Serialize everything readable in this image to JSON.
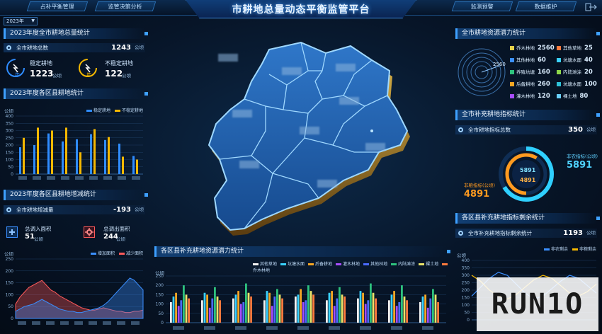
{
  "header": {
    "title": "市耕地总量动态平衡监管平台",
    "nav_left": [
      "占补平衡管理",
      "监管决策分析"
    ],
    "nav_right": [
      "监测预警",
      "数据维护"
    ],
    "year": "2023年",
    "exit_icon": "logout-icon"
  },
  "left": {
    "total": {
      "title": "2023年度全市耕地总量统计",
      "row_label": "全市耕地总数",
      "row_value": "1243",
      "row_unit": "公顷",
      "stable_label": "稳定耕地",
      "stable_value": "1223",
      "stable_unit": "公顷",
      "unstable_label": "不稳定耕地",
      "unstable_value": "122",
      "unstable_unit": "公顷",
      "icon_text": "年"
    },
    "county": {
      "title": "2023年度各区县耕地统计",
      "unit": "公顷",
      "legend": [
        "稳定耕地",
        "不稳定耕地"
      ],
      "colors": [
        "#2f8cff",
        "#f5b800"
      ]
    },
    "change": {
      "title": "2023年度各区县耕地增减统计",
      "row_label": "全市耕地增减量",
      "row_value": "-193",
      "row_unit": "公顷",
      "in_label": "总调入面积",
      "in_value": "51",
      "in_unit": "公顷",
      "out_label": "总调出面积",
      "out_value": "244",
      "out_unit": "公顷",
      "unit": "公顷",
      "legend": [
        "增加面积",
        "减少面积"
      ],
      "colors": [
        "#3b8fff",
        "#ff5a5a"
      ]
    }
  },
  "center": {
    "supp": {
      "title": "各区县补充耕地资源潜力统计",
      "unit": "公顷",
      "legend": [
        "其他草地",
        "坑塘水面",
        "后备耕地",
        "灌木林地",
        "其他林地",
        "内陆滩涂",
        "裸土地",
        "乔木林地"
      ],
      "colors": [
        "#f2f2f2",
        "#3ad1ff",
        "#f5a623",
        "#a64dff",
        "#4a6bff",
        "#2ec27e",
        "#e8e36a",
        "#ff7a3d"
      ]
    }
  },
  "right": {
    "potential": {
      "title": "全市耕地资源潜力统计",
      "ring_value": "2560",
      "items": [
        {
          "label": "乔木林地",
          "value": "2560",
          "color": "#e6d24a"
        },
        {
          "label": "其他草地",
          "value": "25",
          "color": "#ff7a3d"
        },
        {
          "label": "其他林地",
          "value": "60",
          "color": "#3b8fff"
        },
        {
          "label": "坑塘水面",
          "value": "40",
          "color": "#3ad1ff"
        },
        {
          "label": "养殖坑塘",
          "value": "160",
          "color": "#2ec27e"
        },
        {
          "label": "内陆滩涂",
          "value": "20",
          "color": "#8dd84a"
        },
        {
          "label": "后备耕地",
          "value": "260",
          "color": "#f5a623"
        },
        {
          "label": "坑塘水面",
          "value": "100",
          "color": "#2ec2d8"
        },
        {
          "label": "灌木林地",
          "value": "120",
          "color": "#a64dff"
        },
        {
          "label": "裸土地",
          "value": "80",
          "color": "#6ad0ff"
        }
      ]
    },
    "index": {
      "title": "全市补充耕地指标统计",
      "row_label": "全市耕地指标总数",
      "row_value": "350",
      "row_unit": "公顷",
      "ring_a": "5891",
      "ring_b": "4891",
      "label_a": "非农指标(公顷)",
      "value_a": "5891",
      "label_b": "非粮指标(公顷)",
      "value_b": "4891"
    },
    "remain": {
      "title": "各区县补充耕地指标剩余统计",
      "row_label": "全市补充耕地指标剩余统计",
      "row_value": "1193",
      "row_unit": "公顷",
      "unit": "公顷",
      "legend": [
        "非农剩余",
        "非粮剩余"
      ],
      "colors": [
        "#3b8fff",
        "#f5b800"
      ]
    }
  },
  "chart_data": [
    {
      "type": "bar",
      "title": "2023年度各区县耕地统计",
      "ylabel": "公顷",
      "ylim": [
        0,
        400
      ],
      "yticks": [
        0,
        50,
        100,
        150,
        200,
        250,
        300,
        350,
        400
      ],
      "categories": [
        "",
        "",
        "",
        "",
        "",
        "",
        "",
        "",
        ""
      ],
      "series": [
        {
          "name": "稳定耕地",
          "values": [
            185,
            200,
            280,
            225,
            240,
            275,
            235,
            210,
            125
          ]
        },
        {
          "name": "不稳定耕地",
          "values": [
            250,
            320,
            300,
            320,
            150,
            310,
            255,
            120,
            100
          ]
        }
      ]
    },
    {
      "type": "area",
      "title": "2023年度各区县耕地增减统计",
      "ylabel": "公顷",
      "ylim": [
        0,
        250
      ],
      "yticks": [
        0,
        50,
        100,
        150,
        200,
        250
      ],
      "series": [
        {
          "name": "增加面积",
          "values": [
            30,
            40,
            50,
            55,
            60,
            70,
            80,
            70,
            60,
            50,
            40,
            35,
            30,
            30,
            25,
            25,
            30,
            35,
            40,
            45,
            55,
            70,
            90,
            110,
            130,
            150,
            170,
            160,
            140,
            120
          ]
        },
        {
          "name": "减少面积",
          "values": [
            60,
            90,
            110,
            130,
            140,
            150,
            160,
            140,
            120,
            110,
            95,
            85,
            75,
            65,
            55,
            45,
            40,
            35,
            35,
            40,
            45,
            40,
            35,
            30,
            30,
            25,
            25,
            30,
            30,
            35
          ]
        }
      ]
    },
    {
      "type": "bar",
      "title": "各区县补充耕地资源潜力统计",
      "ylabel": "公顷",
      "ylim": [
        0,
        250
      ],
      "yticks": [
        0,
        50,
        100,
        150,
        200,
        250
      ],
      "categories": [
        "",
        "",
        "",
        "",
        "",
        "",
        "",
        "",
        ""
      ],
      "series": [
        {
          "name": "其他草地",
          "values": [
            110,
            120,
            130,
            120,
            140,
            120,
            130,
            120,
            110
          ]
        },
        {
          "name": "坑塘水面",
          "values": [
            140,
            160,
            150,
            170,
            150,
            160,
            170,
            150,
            140
          ]
        },
        {
          "name": "后备耕地",
          "values": [
            160,
            150,
            170,
            160,
            180,
            170,
            160,
            170,
            150
          ]
        },
        {
          "name": "灌木林地",
          "values": [
            90,
            80,
            100,
            90,
            110,
            90,
            100,
            90,
            80
          ]
        },
        {
          "name": "其他林地",
          "values": [
            120,
            130,
            110,
            140,
            120,
            130,
            120,
            110,
            130
          ]
        },
        {
          "name": "内陆滩涂",
          "values": [
            200,
            190,
            210,
            180,
            200,
            190,
            210,
            200,
            180
          ]
        },
        {
          "name": "裸土地",
          "values": [
            150,
            140,
            160,
            150,
            170,
            150,
            160,
            140,
            150
          ]
        },
        {
          "name": "乔木林地",
          "values": [
            130,
            120,
            140,
            130,
            150,
            140,
            130,
            120,
            110
          ]
        }
      ]
    },
    {
      "type": "line",
      "title": "各区县补充耕地指标剩余统计",
      "ylabel": "公顷",
      "ylim": [
        0,
        400
      ],
      "yticks": [
        0,
        50,
        100,
        150,
        200,
        250,
        300,
        350,
        400
      ],
      "series": [
        {
          "name": "非农剩余",
          "values": [
            160,
            220,
            280,
            320,
            300,
            240,
            180,
            140,
            160,
            210,
            260,
            300,
            280,
            230,
            180
          ]
        },
        {
          "name": "非粮剩余",
          "values": [
            300,
            260,
            200,
            160,
            140,
            170,
            220,
            270,
            300,
            280,
            230,
            180,
            160,
            190,
            240
          ]
        }
      ]
    }
  ]
}
